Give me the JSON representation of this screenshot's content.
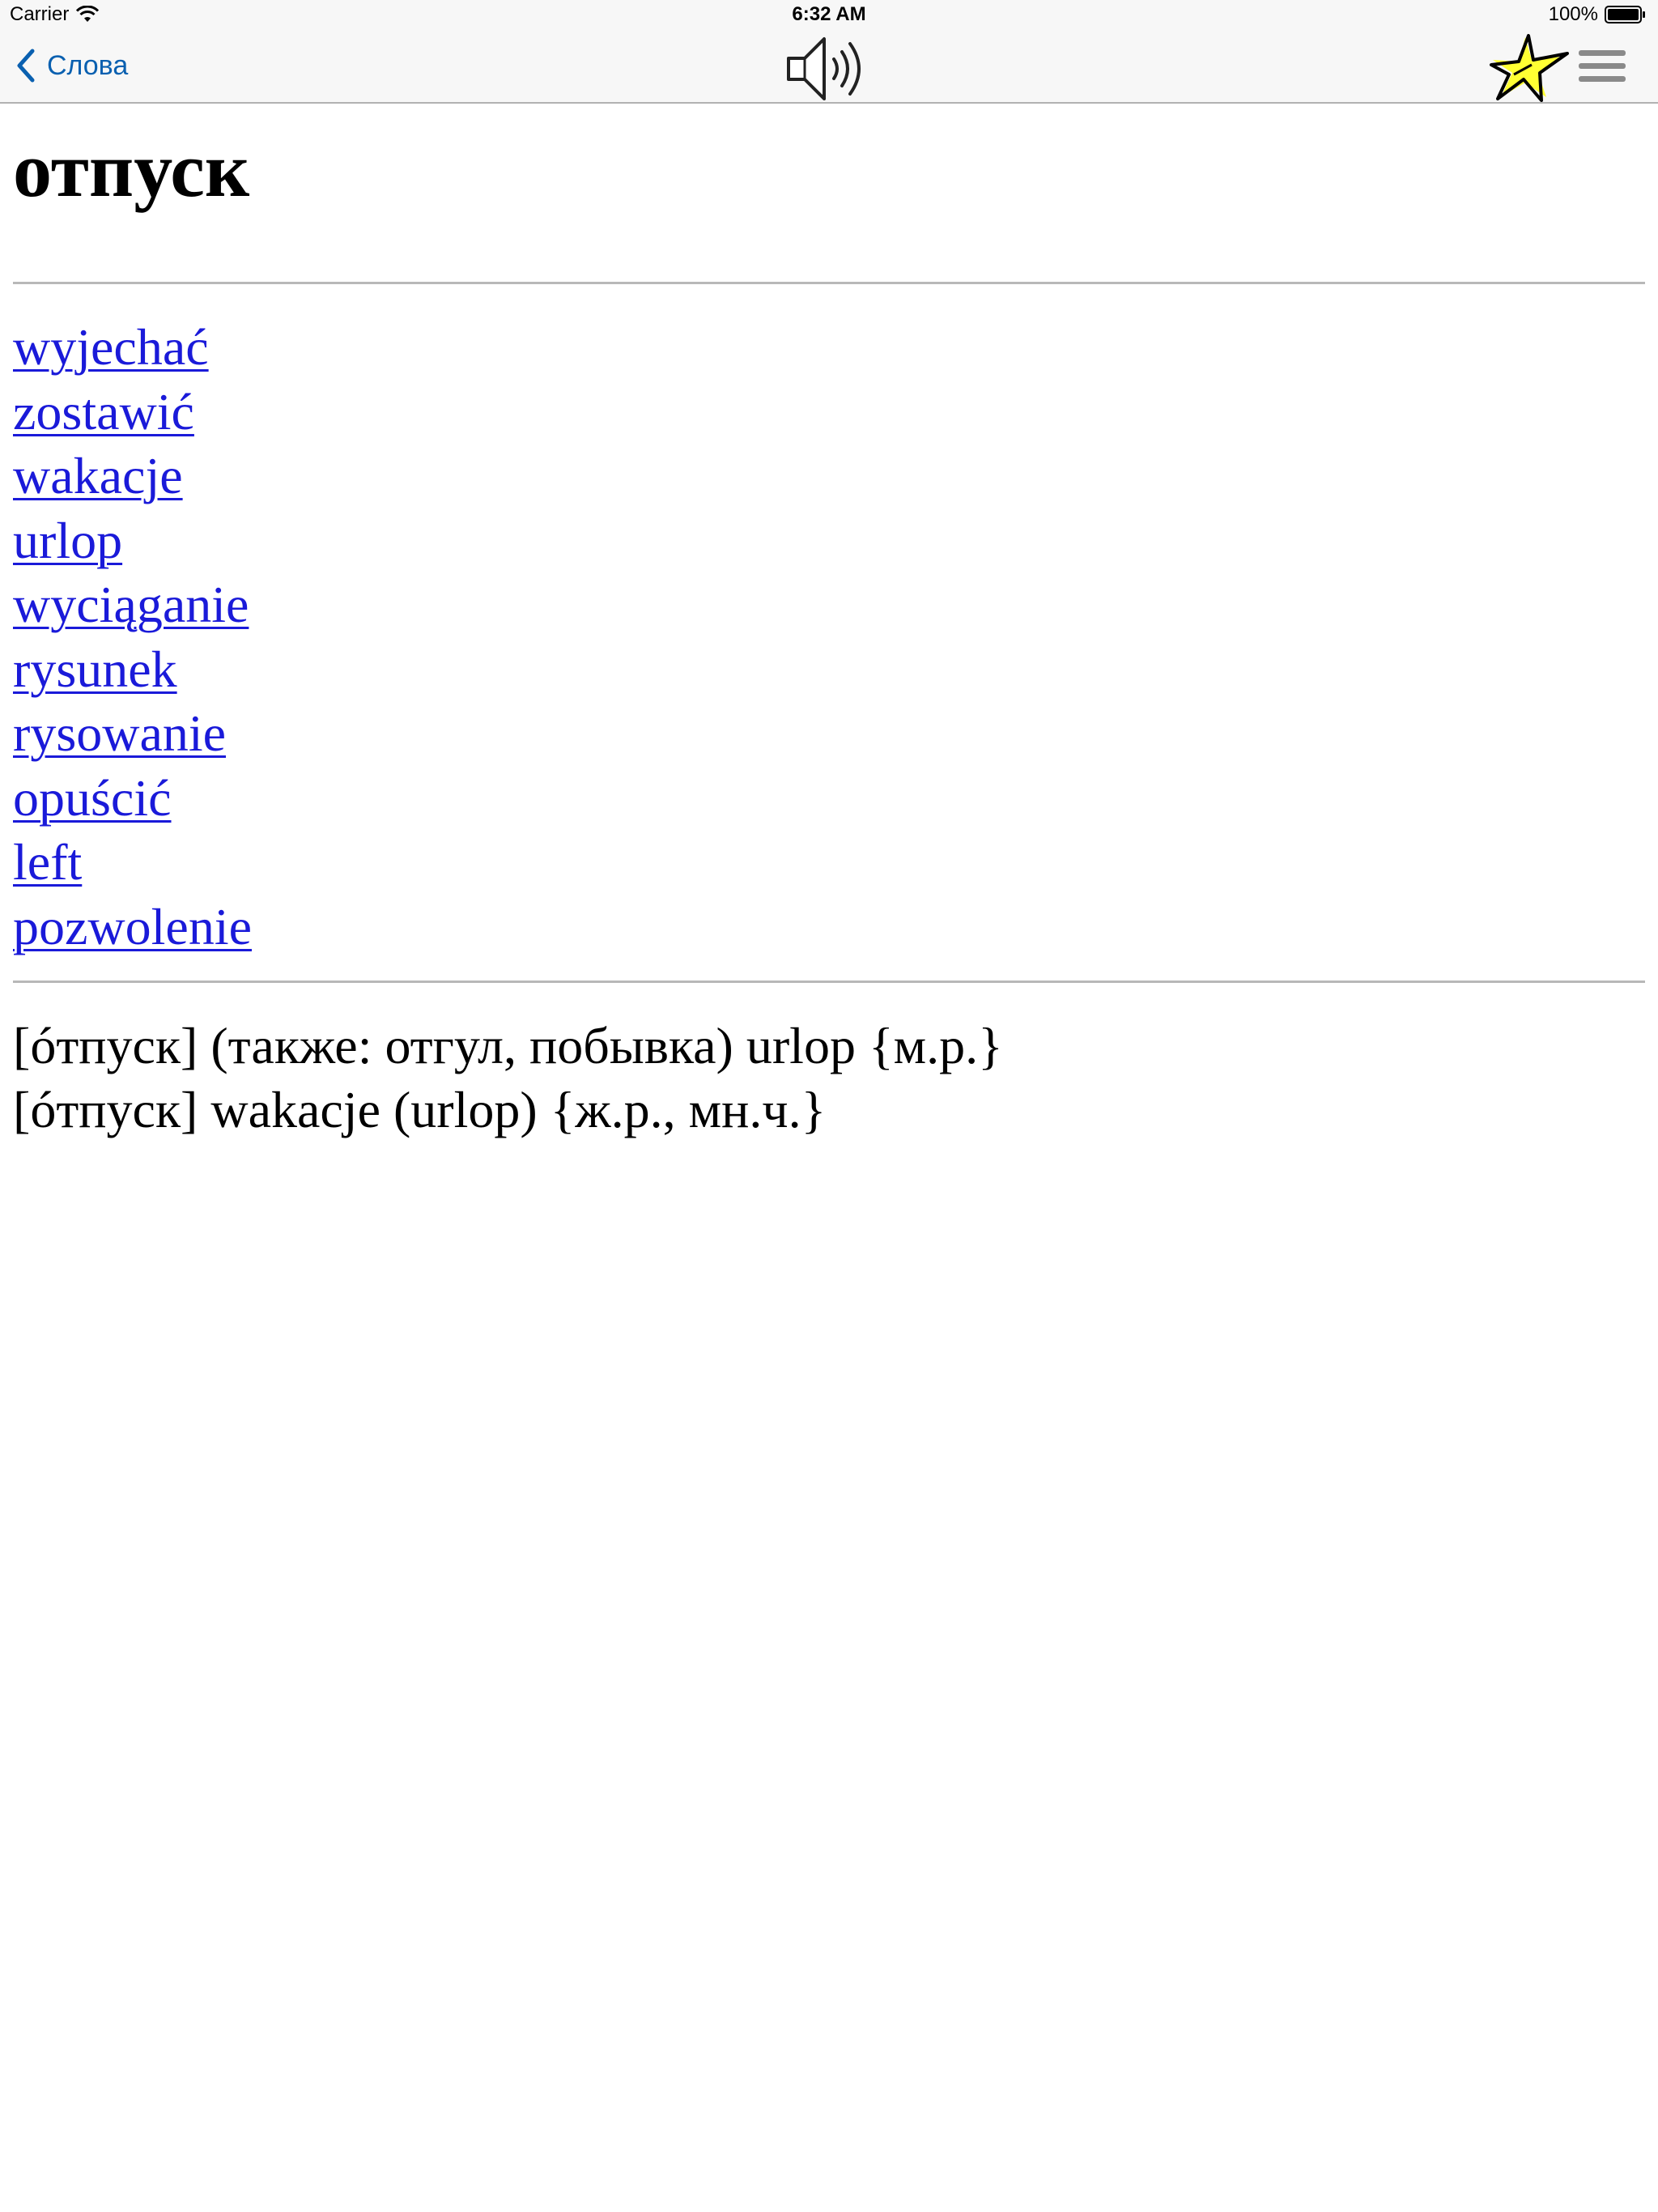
{
  "status_bar": {
    "carrier": "Carrier",
    "time": "6:32 AM",
    "battery": "100%"
  },
  "nav": {
    "back_label": "Слова",
    "icons": {
      "back": "chevron-left-icon",
      "speaker": "speaker-icon",
      "favorite": "star-icon",
      "menu": "hamburger-menu-icon"
    },
    "accent_color": "#0a60b0",
    "star_color": "#ffff33"
  },
  "entry": {
    "headword": "отпуск",
    "related_links": [
      "wyjechać",
      "zostawić",
      "wakacje",
      "urlop",
      "wyciąganie",
      "rysunek",
      "rysowanie",
      "opuścić",
      "left",
      "pozwolenie"
    ],
    "link_color": "#1a1ad9",
    "definitions": [
      "[óтпуск] (также: отгул, побывка) urlop {м.р.}",
      "[óтпуск] wakacje (urlop) {ж.р., мн.ч.}"
    ]
  }
}
